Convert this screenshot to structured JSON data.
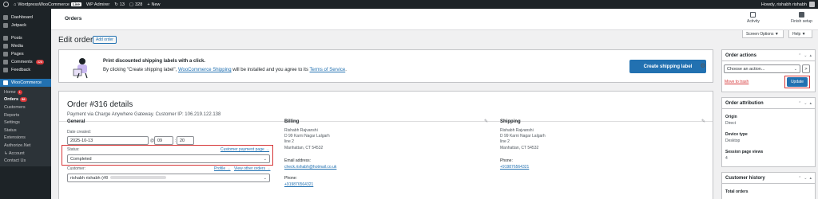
{
  "admin_bar": {
    "site_name": "WordpressWooCommerce",
    "live_badge": "Live",
    "wp_admin": "WP Admirer",
    "updates_count": "13",
    "comments_count": "328",
    "new_label": "New",
    "howdy": "Howdy, rishabh rishabh"
  },
  "sidebar": {
    "items_top": [
      {
        "label": "Dashboard",
        "icon": "dashboard-icon"
      },
      {
        "label": "Jetpack",
        "icon": "jetpack-icon"
      }
    ],
    "items_mid": [
      {
        "label": "Posts",
        "icon": "pin-icon"
      },
      {
        "label": "Media",
        "icon": "media-icon"
      },
      {
        "label": "Pages",
        "icon": "pages-icon"
      },
      {
        "label": "Comments",
        "icon": "comment-icon",
        "badge": "328"
      },
      {
        "label": "Feedback",
        "icon": "feedback-icon"
      }
    ],
    "woocommerce": {
      "label": "WooCommerce",
      "icon": "woo-icon"
    },
    "submenu": [
      {
        "label": "Home",
        "badge": "1"
      },
      {
        "label": "Orders",
        "badge": "58",
        "current": true
      },
      {
        "label": "Customers"
      },
      {
        "label": "Reports"
      },
      {
        "label": "Settings"
      },
      {
        "label": "Status"
      },
      {
        "label": "Extensions"
      },
      {
        "label": "Authorize.Net"
      },
      {
        "label": "↳ Account"
      },
      {
        "label": "Contact Us"
      }
    ]
  },
  "header": {
    "title": "Orders",
    "activity_label": "Activity",
    "finish_setup_label": "Finish setup"
  },
  "screen_options": {
    "label": "Screen Options ▼"
  },
  "help": {
    "label": "Help ▼"
  },
  "page": {
    "title": "Edit order",
    "add_order": "Add order"
  },
  "banner": {
    "headline": "Print discounted shipping labels with a click.",
    "text_before": "By clicking \"Create shipping label\",",
    "link1": "WooCommerce Shipping",
    "text_mid": "will be installed and you agree to its",
    "link2": "Terms of Service",
    "text_end": ".",
    "button": "Create shipping label"
  },
  "order": {
    "heading": "Order #316 details",
    "subline": "Payment via Charge Anywhere Gateway. Customer IP: 106.219.122.138",
    "general": {
      "heading": "General",
      "date_label": "Date created:",
      "date_value": "2025-10-13",
      "at": "@",
      "hour": "09",
      "minute": "20",
      "status_label": "Status:",
      "customer_payment_link": "Customer payment page →",
      "status_value": "Completed",
      "customer_label": "Customer:",
      "profile_link": "Profile →",
      "view_orders_link": "View other orders →",
      "customer_value": "rishabh rishabh (#8"
    },
    "billing": {
      "heading": "Billing",
      "lines": [
        "Rishabh Rajvanshi",
        "D 99 Karni Nagar Lalgarh",
        "line 2",
        "Manhattan, CT 54532"
      ],
      "email_label": "Email address:",
      "email": "check.rishabh@hotmail.co.uk",
      "phone_label": "Phone:",
      "phone": "+919876564321"
    },
    "shipping": {
      "heading": "Shipping",
      "lines": [
        "Rishabh Rajvanshi",
        "D 99 Karni Nagar Lalgarh",
        "line 2",
        "Manhattan, CT 54532"
      ],
      "phone_label": "Phone:",
      "phone": "+919876564321"
    }
  },
  "order_actions": {
    "heading": "Order actions",
    "select_placeholder": "Choose an action...",
    "go": ">",
    "trash": "Move to trash",
    "update": "Update"
  },
  "order_attribution": {
    "heading": "Order attribution",
    "origin_label": "Origin",
    "origin_value": "Direct",
    "device_label": "Device type",
    "device_value": "Desktop",
    "views_label": "Session page views",
    "views_value": "4"
  },
  "customer_history": {
    "heading": "Customer history",
    "total_orders_label": "Total orders"
  },
  "colors": {
    "admin_dark": "#1d2327",
    "primary": "#2271b1",
    "highlight_red": "#d63638"
  }
}
